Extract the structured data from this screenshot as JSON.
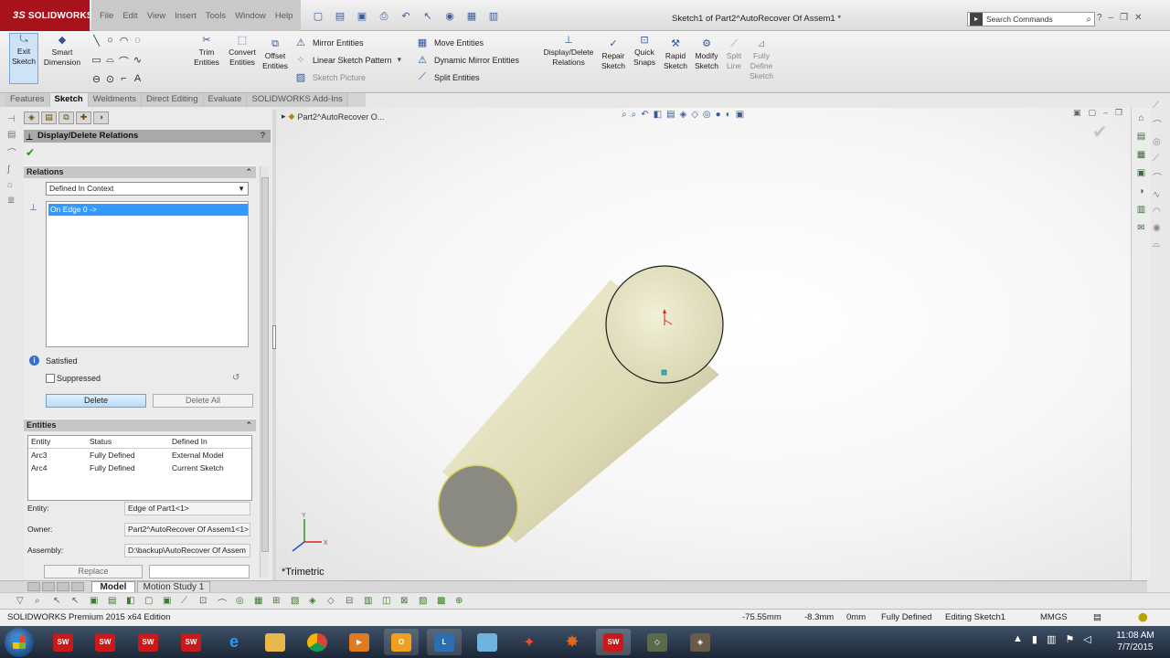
{
  "app": {
    "logo_text": "SOLIDWORKS",
    "menus": [
      "File",
      "Edit",
      "View",
      "Insert",
      "Tools",
      "Window",
      "Help"
    ],
    "doc_title": "Sketch1 of Part2^AutoRecover Of Assem1 *",
    "search_placeholder": "Search Commands"
  },
  "ribbon": {
    "exit_sketch": "Exit Sketch",
    "smart_dimension": "Smart Dimension",
    "trim_entities": "Trim Entities",
    "convert_entities": "Convert Entities",
    "offset_entities": "Offset Entities",
    "mirror_entities": "Mirror Entities",
    "linear_sketch_pattern": "Linear Sketch Pattern",
    "sketch_picture": "Sketch Picture",
    "move_entities": "Move Entities",
    "dynamic_mirror": "Dynamic Mirror Entities",
    "split_entities": "Split Entities",
    "display_delete_relations": "Display/Delete Relations",
    "repair_sketch": "Repair Sketch",
    "quick_snaps": "Quick Snaps",
    "rapid_sketch": "Rapid Sketch",
    "modify_sketch": "Modify Sketch",
    "split_line": "Split Line",
    "fully_define_sketch": "Fully Define Sketch"
  },
  "tabs": [
    "Features",
    "Sketch",
    "Weldments",
    "Direct Editing",
    "Evaluate",
    "SOLIDWORKS Add-Ins"
  ],
  "active_tab": "Sketch",
  "property_manager": {
    "title": "Display/Delete Relations",
    "help": "?",
    "relations_header": "Relations",
    "filter_value": "Defined In Context",
    "relations": [
      "On Edge 0 ->"
    ],
    "status": "Satisfied",
    "suppressed_label": "Suppressed",
    "delete_label": "Delete",
    "delete_all_label": "Delete All",
    "entities_header": "Entities",
    "entities_columns": [
      "Entity",
      "Status",
      "Defined In"
    ],
    "entities_rows": [
      [
        "Arc3",
        "Fully Defined",
        "External Model"
      ],
      [
        "Arc4",
        "Fully Defined",
        "Current Sketch"
      ]
    ],
    "entity_label": "Entity:",
    "entity_value": "Edge of Part1<1>",
    "owner_label": "Owner:",
    "owner_value": "Part2^AutoRecover Of Assem1<1>",
    "assembly_label": "Assembly:",
    "assembly_value": "D:\\backup\\AutoRecover Of Assem",
    "replace_label": "Replace"
  },
  "viewport": {
    "tree_node": "Part2^AutoRecover O...",
    "view_orientation": "*Trimetric"
  },
  "bottom_tabs": [
    "Model",
    "Motion Study 1"
  ],
  "status_bar": {
    "edition": "SOLIDWORKS Premium 2015 x64 Edition",
    "x": "-75.55mm",
    "y": "-8.3mm",
    "z": "0mm",
    "sketch_status": "Fully Defined",
    "editing": "Editing Sketch1",
    "units": "MMGS"
  },
  "clock": {
    "time": "11:08 AM",
    "date": "7/7/2015"
  },
  "colors": {
    "logo_red": "#a8131b",
    "selection_blue": "#3399ff",
    "cylinder_body": "#e3e1c0",
    "cylinder_end": "#8a8a80"
  }
}
